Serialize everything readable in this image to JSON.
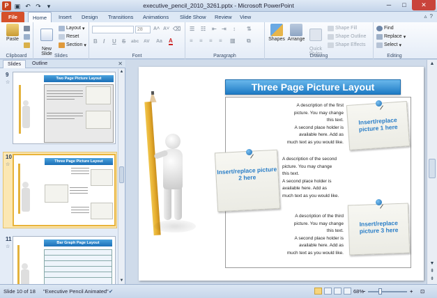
{
  "app": {
    "title": "executive_pencil_2010_3261.pptx - Microsoft PowerPoint"
  },
  "tabs": [
    "File",
    "Home",
    "Insert",
    "Design",
    "Transitions",
    "Animations",
    "Slide Show",
    "Review",
    "View"
  ],
  "ribbon": {
    "clipboard": {
      "paste": "Paste",
      "label": "Clipboard"
    },
    "slides": {
      "new_slide": "New\nSlide",
      "layout": "Layout",
      "reset": "Reset",
      "section": "Section",
      "label": "Slides"
    },
    "font": {
      "size": "28",
      "bold": "B",
      "italic": "I",
      "underline": "U",
      "strike": "S",
      "shadow": "abc",
      "spacing": "AV",
      "case": "Aa",
      "color": "A",
      "label": "Font"
    },
    "paragraph": {
      "label": "Paragraph"
    },
    "drawing": {
      "shapes": "Shapes",
      "arrange": "Arrange",
      "quick_styles": "Quick\nStyles",
      "shape_fill": "Shape Fill",
      "shape_outline": "Shape Outline",
      "shape_effects": "Shape Effects",
      "label": "Drawing"
    },
    "editing": {
      "find": "Find",
      "replace": "Replace",
      "select": "Select",
      "label": "Editing"
    }
  },
  "panel": {
    "tabs": [
      "Slides",
      "Outline"
    ],
    "thumbnails": [
      {
        "number": "9",
        "title": "Two Page Picture Layout"
      },
      {
        "number": "10",
        "title": "Three Page Picture Layout"
      },
      {
        "number": "11",
        "title": "Bar Graph Page Layout"
      }
    ]
  },
  "slide": {
    "title": "Three Page Picture Layout",
    "desc1": [
      "A description of the first",
      "picture.  You may change",
      "this text.",
      "A second place holder is",
      "available here.  Add as",
      "much text as you would like."
    ],
    "desc2": [
      "A description of the second",
      "picture.  You may change",
      "this text.",
      "A second place holder is",
      "available here.  Add as",
      "much text as you would like."
    ],
    "desc3": [
      "A description of the third",
      "picture.  You may change",
      "this text.",
      "A second place holder is",
      "available here.  Add as",
      "much text as you would like."
    ],
    "note1": "Insert/replace picture 1 here",
    "note2": "Insert/replace picture 2 here",
    "note3": "Insert/replace picture 3 here"
  },
  "status": {
    "slide_info": "Slide 10 of 18",
    "theme": "\"Executive Pencil Animated\"",
    "zoom": "68%"
  }
}
